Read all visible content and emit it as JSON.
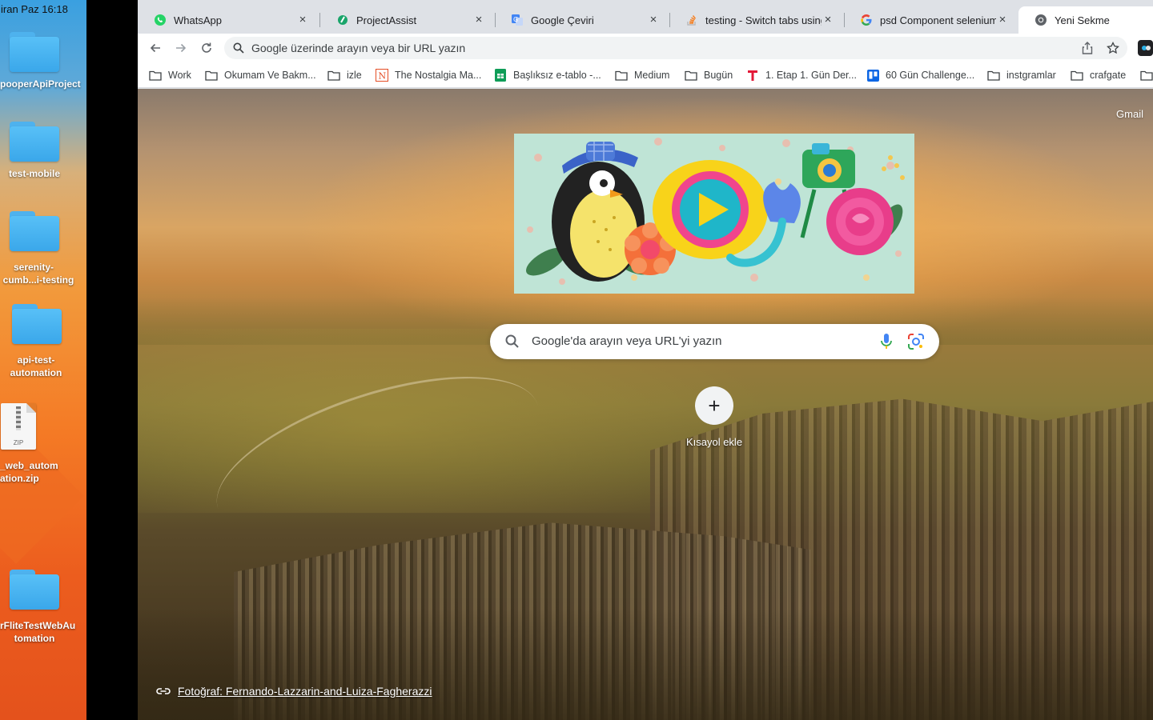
{
  "desktop": {
    "clock": "iran Paz  16:18",
    "items": [
      {
        "label": "pooperApiProject",
        "kind": "folder"
      },
      {
        "label": "test-mobile",
        "kind": "folder"
      },
      {
        "label_line1": "serenity-",
        "label_line2": "cumb...i-testing",
        "kind": "folder"
      },
      {
        "label_line1": "api-test-",
        "label_line2": "automation",
        "kind": "folder"
      },
      {
        "label_line1": "_web_autom",
        "label_line2": "ation.zip",
        "kind": "zip",
        "badge": "ZIP"
      },
      {
        "label_line1": "rFliteTestWebAu",
        "label_line2": "tomation",
        "kind": "folder"
      }
    ]
  },
  "browser": {
    "tabs": [
      {
        "title": "WhatsApp",
        "icon": "whatsapp-icon",
        "color": "#25D366"
      },
      {
        "title": "ProjectAssist",
        "icon": "projectassist-icon",
        "color": "#1aa56b"
      },
      {
        "title": "Google Çeviri",
        "icon": "google-translate-icon",
        "color": "#4285f4"
      },
      {
        "title": "testing - Switch tabs using",
        "icon": "stackoverflow-icon",
        "color": "#f48024"
      },
      {
        "title": "psd Component selenium ir",
        "icon": "google-icon",
        "color": "#4285f4"
      },
      {
        "title": "Yeni Sekme",
        "icon": "chrome-icon",
        "color": "#5f6368",
        "active": true
      }
    ],
    "omnibox_placeholder": "Google üzerinde arayın veya bir URL yazın",
    "bookmarks": [
      {
        "label": "Work",
        "icon": "folder-icon"
      },
      {
        "label": "Okumam Ve Bakm...",
        "icon": "folder-icon"
      },
      {
        "label": "izle",
        "icon": "folder-icon"
      },
      {
        "label": "The Nostalgia Ma...",
        "icon": "nostalgia-icon"
      },
      {
        "label": "Başlıksız e-tablo -...",
        "icon": "sheets-icon"
      },
      {
        "label": "Medium",
        "icon": "folder-icon"
      },
      {
        "label": "Bugün",
        "icon": "folder-icon"
      },
      {
        "label": "1. Etap 1. Gün Der...",
        "icon": "t-icon"
      },
      {
        "label": "60 Gün Challenge...",
        "icon": "trello-icon"
      },
      {
        "label": "instgramlar",
        "icon": "folder-icon"
      },
      {
        "label": "crafgate",
        "icon": "folder-icon"
      }
    ]
  },
  "ntp": {
    "gmail": "Gmail",
    "search_placeholder": "Google'da arayın veya URL'yi yazın",
    "shortcut_label": "Kısayol ekle",
    "credit": "Fotoğraf: Fernando-Lazzarin-and-Luiza-Fagherazzi"
  },
  "colors": {
    "tabstrip": "#dee1e6",
    "toolbar": "#ffffff",
    "omnibox": "#f1f3f4"
  }
}
